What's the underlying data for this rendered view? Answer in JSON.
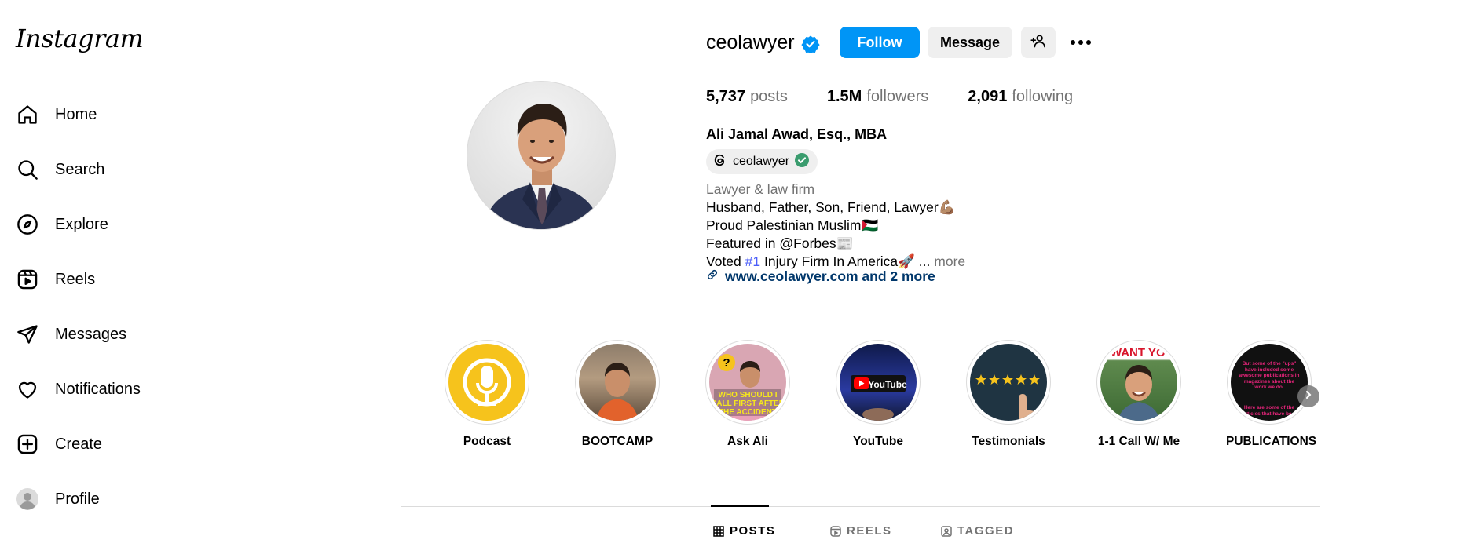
{
  "app": {
    "logo": "Instagram"
  },
  "nav": [
    {
      "label": "Home",
      "icon": "home-icon"
    },
    {
      "label": "Search",
      "icon": "search-icon"
    },
    {
      "label": "Explore",
      "icon": "compass-icon"
    },
    {
      "label": "Reels",
      "icon": "reels-icon"
    },
    {
      "label": "Messages",
      "icon": "send-icon"
    },
    {
      "label": "Notifications",
      "icon": "heart-icon"
    },
    {
      "label": "Create",
      "icon": "plus-square-icon"
    },
    {
      "label": "Profile",
      "icon": "profile-avatar-icon"
    }
  ],
  "profile": {
    "username": "ceolawyer",
    "follow_label": "Follow",
    "message_label": "Message",
    "stats": {
      "posts_count": "5,737",
      "posts_label": "posts",
      "followers_count": "1.5M",
      "followers_label": "followers",
      "following_count": "2,091",
      "following_label": "following"
    },
    "full_name": "Ali Jamal Awad, Esq., MBA",
    "threads_handle": "ceolawyer",
    "bio": {
      "category": "Lawyer & law firm",
      "line1": "Husband, Father, Son, Friend, Lawyer💪🏽",
      "line2": "Proud Palestinian Muslim🇵🇸",
      "line3": "Featured in @Forbes📰",
      "line4_pre": "Voted ",
      "line4_tag": "#1",
      "line4_post": " Injury Firm In America🚀 ...",
      "more_label": "more",
      "link_label": "www.ceolawyer.com and 2 more"
    }
  },
  "highlights": [
    {
      "label": "Podcast"
    },
    {
      "label": "BOOTCAMP"
    },
    {
      "label": "Ask Ali",
      "overlay_text": "WHO SHOULD I CALL FIRST AFTER THE ACCIDENT"
    },
    {
      "label": "YouTube",
      "overlay_text": "YouTube"
    },
    {
      "label": "Testimonials"
    },
    {
      "label": "1-1 Call W/ Me",
      "overlay_text": "I WANT YOU"
    },
    {
      "label": "PUBLICATIONS",
      "overlay_text_top": "But some of the \"ups\" have included some awesome publications in magazines about the work we do.",
      "overlay_text_bottom": "Here are some of the articles that have be..."
    }
  ],
  "tabs": [
    {
      "label": "POSTS",
      "icon": "grid-icon",
      "active": true
    },
    {
      "label": "REELS",
      "icon": "reels-small-icon",
      "active": false
    },
    {
      "label": "TAGGED",
      "icon": "tagged-icon",
      "active": false
    }
  ],
  "colors": {
    "follow_blue": "#0095f6",
    "link_blue": "#00376b",
    "tag_blue": "#4a5df9",
    "muted": "#737373"
  }
}
